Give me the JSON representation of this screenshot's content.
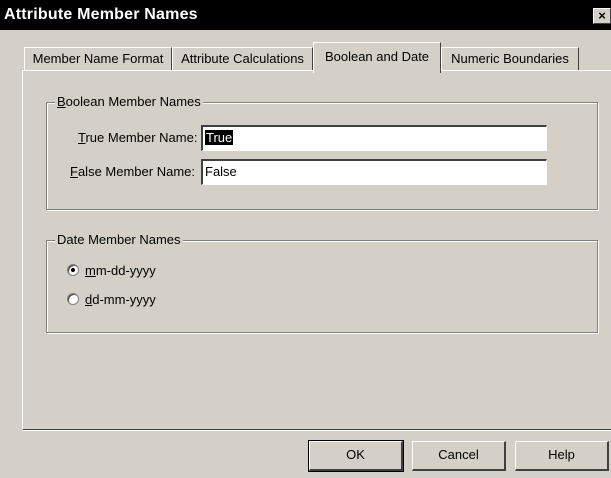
{
  "window": {
    "title": "Attribute Member Names",
    "close_glyph": "×"
  },
  "tabs": [
    {
      "label": "Member Name Format"
    },
    {
      "label": "Attribute Calculations"
    },
    {
      "label": "Boolean and Date",
      "active": true
    },
    {
      "label": "Numeric Boundaries"
    }
  ],
  "boolean_group": {
    "label_mnemonic": "B",
    "label_rest": "oolean Member Names",
    "true_label_mnemonic": "T",
    "true_label_rest": "rue Member Name:",
    "true_value": "True",
    "false_label_mnemonic": "F",
    "false_label_rest": "alse Member Name:",
    "false_value": "False"
  },
  "date_group": {
    "label": "Date Member Names",
    "options": [
      {
        "mnemonic": "m",
        "rest": "m-dd-yyyy",
        "selected": true
      },
      {
        "mnemonic": "d",
        "rest": "d-mm-yyyy",
        "selected": false
      }
    ]
  },
  "buttons": {
    "ok": "OK",
    "cancel": "Cancel",
    "help": "Help"
  }
}
